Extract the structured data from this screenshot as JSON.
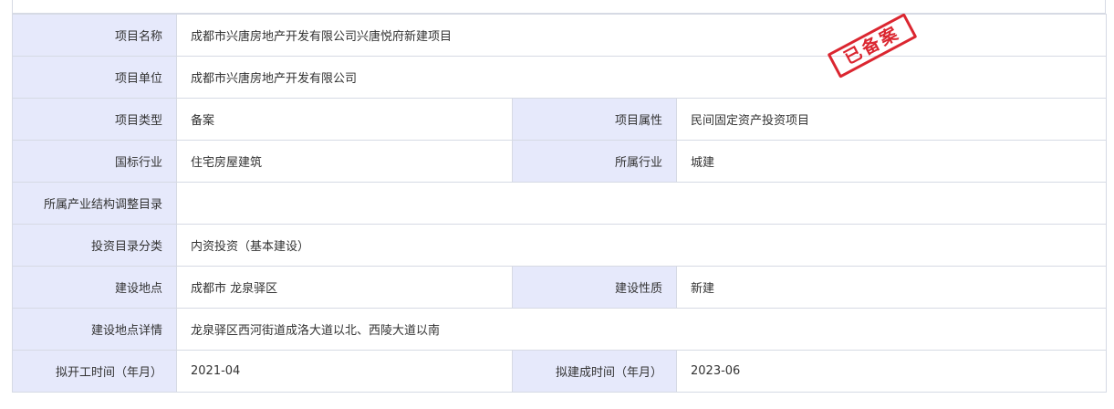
{
  "rows": [
    {
      "label": "项目名称",
      "value": "成都市兴唐房地产开发有限公司兴唐悦府新建项目"
    },
    {
      "label": "项目单位",
      "value": "成都市兴唐房地产开发有限公司"
    },
    {
      "label": "项目类型",
      "value": "备案",
      "label2": "项目属性",
      "value2": "民间固定资产投资项目"
    },
    {
      "label": "国标行业",
      "value": "住宅房屋建筑",
      "label2": "所属行业",
      "value2": "城建"
    },
    {
      "label": "所属产业结构调整目录",
      "value": ""
    },
    {
      "label": "投资目录分类",
      "value": "内资投资（基本建设）"
    },
    {
      "label": "建设地点",
      "value": "成都市 龙泉驿区",
      "label2": "建设性质",
      "value2": "新建"
    },
    {
      "label": "建设地点详情",
      "value": "龙泉驿区西河街道成洛大道以北、西陵大道以南"
    },
    {
      "label": "拟开工时间（年月）",
      "value": "2021-04",
      "label2": "拟建成时间（年月）",
      "value2": "2023-06"
    }
  ],
  "stamp": {
    "text": "已备案",
    "color": "#d8141f"
  },
  "colors": {
    "label_bg": "#e6e9fb",
    "border": "#d6dae4",
    "text": "#333333"
  }
}
